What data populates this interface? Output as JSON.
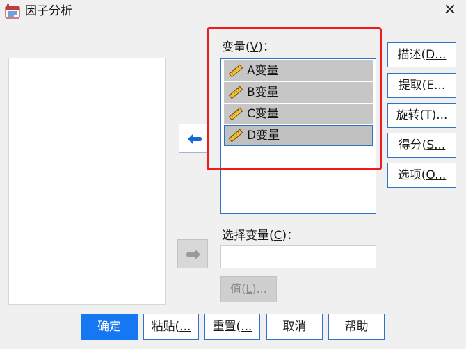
{
  "window": {
    "title": "因子分析",
    "close_glyph": "✕"
  },
  "variables_panel": {
    "label_prefix": "变量(",
    "label_key": "V",
    "label_suffix": ")：",
    "items": [
      {
        "label": "A变量",
        "icon": "scale-ruler-icon",
        "selected": false
      },
      {
        "label": "B变量",
        "icon": "scale-ruler-icon",
        "selected": false
      },
      {
        "label": "C变量",
        "icon": "scale-ruler-icon",
        "selected": false
      },
      {
        "label": "D变量",
        "icon": "scale-ruler-icon",
        "selected": true
      }
    ]
  },
  "selection_panel": {
    "label_prefix": "选择变量(",
    "label_key": "C",
    "label_suffix": ")：",
    "value_button": {
      "prefix": "值(",
      "key": "L",
      "suffix": ")..."
    }
  },
  "side_buttons": [
    {
      "prefix": "描述(",
      "key": "D",
      "suffix": "..."
    },
    {
      "prefix": "提取(",
      "key": "E",
      "suffix": "..."
    },
    {
      "prefix": "旋转(",
      "key": "T",
      "suffix": ")..."
    },
    {
      "prefix": "得分(",
      "key": "S",
      "suffix": "..."
    },
    {
      "prefix": "选项(",
      "key": "O",
      "suffix": "..."
    }
  ],
  "bottom_buttons": {
    "ok": "确定",
    "paste": {
      "prefix": "粘贴(",
      "key": "",
      "suffix": "..."
    },
    "reset": {
      "prefix": "重置(",
      "key": "",
      "suffix": "..."
    },
    "cancel": "取消",
    "help": "帮助"
  },
  "colors": {
    "accent": "#2e73c8",
    "primary_button": "#1677f2",
    "highlight_box": "#ee1c1c",
    "arrow_icon": "#1a66d6"
  }
}
